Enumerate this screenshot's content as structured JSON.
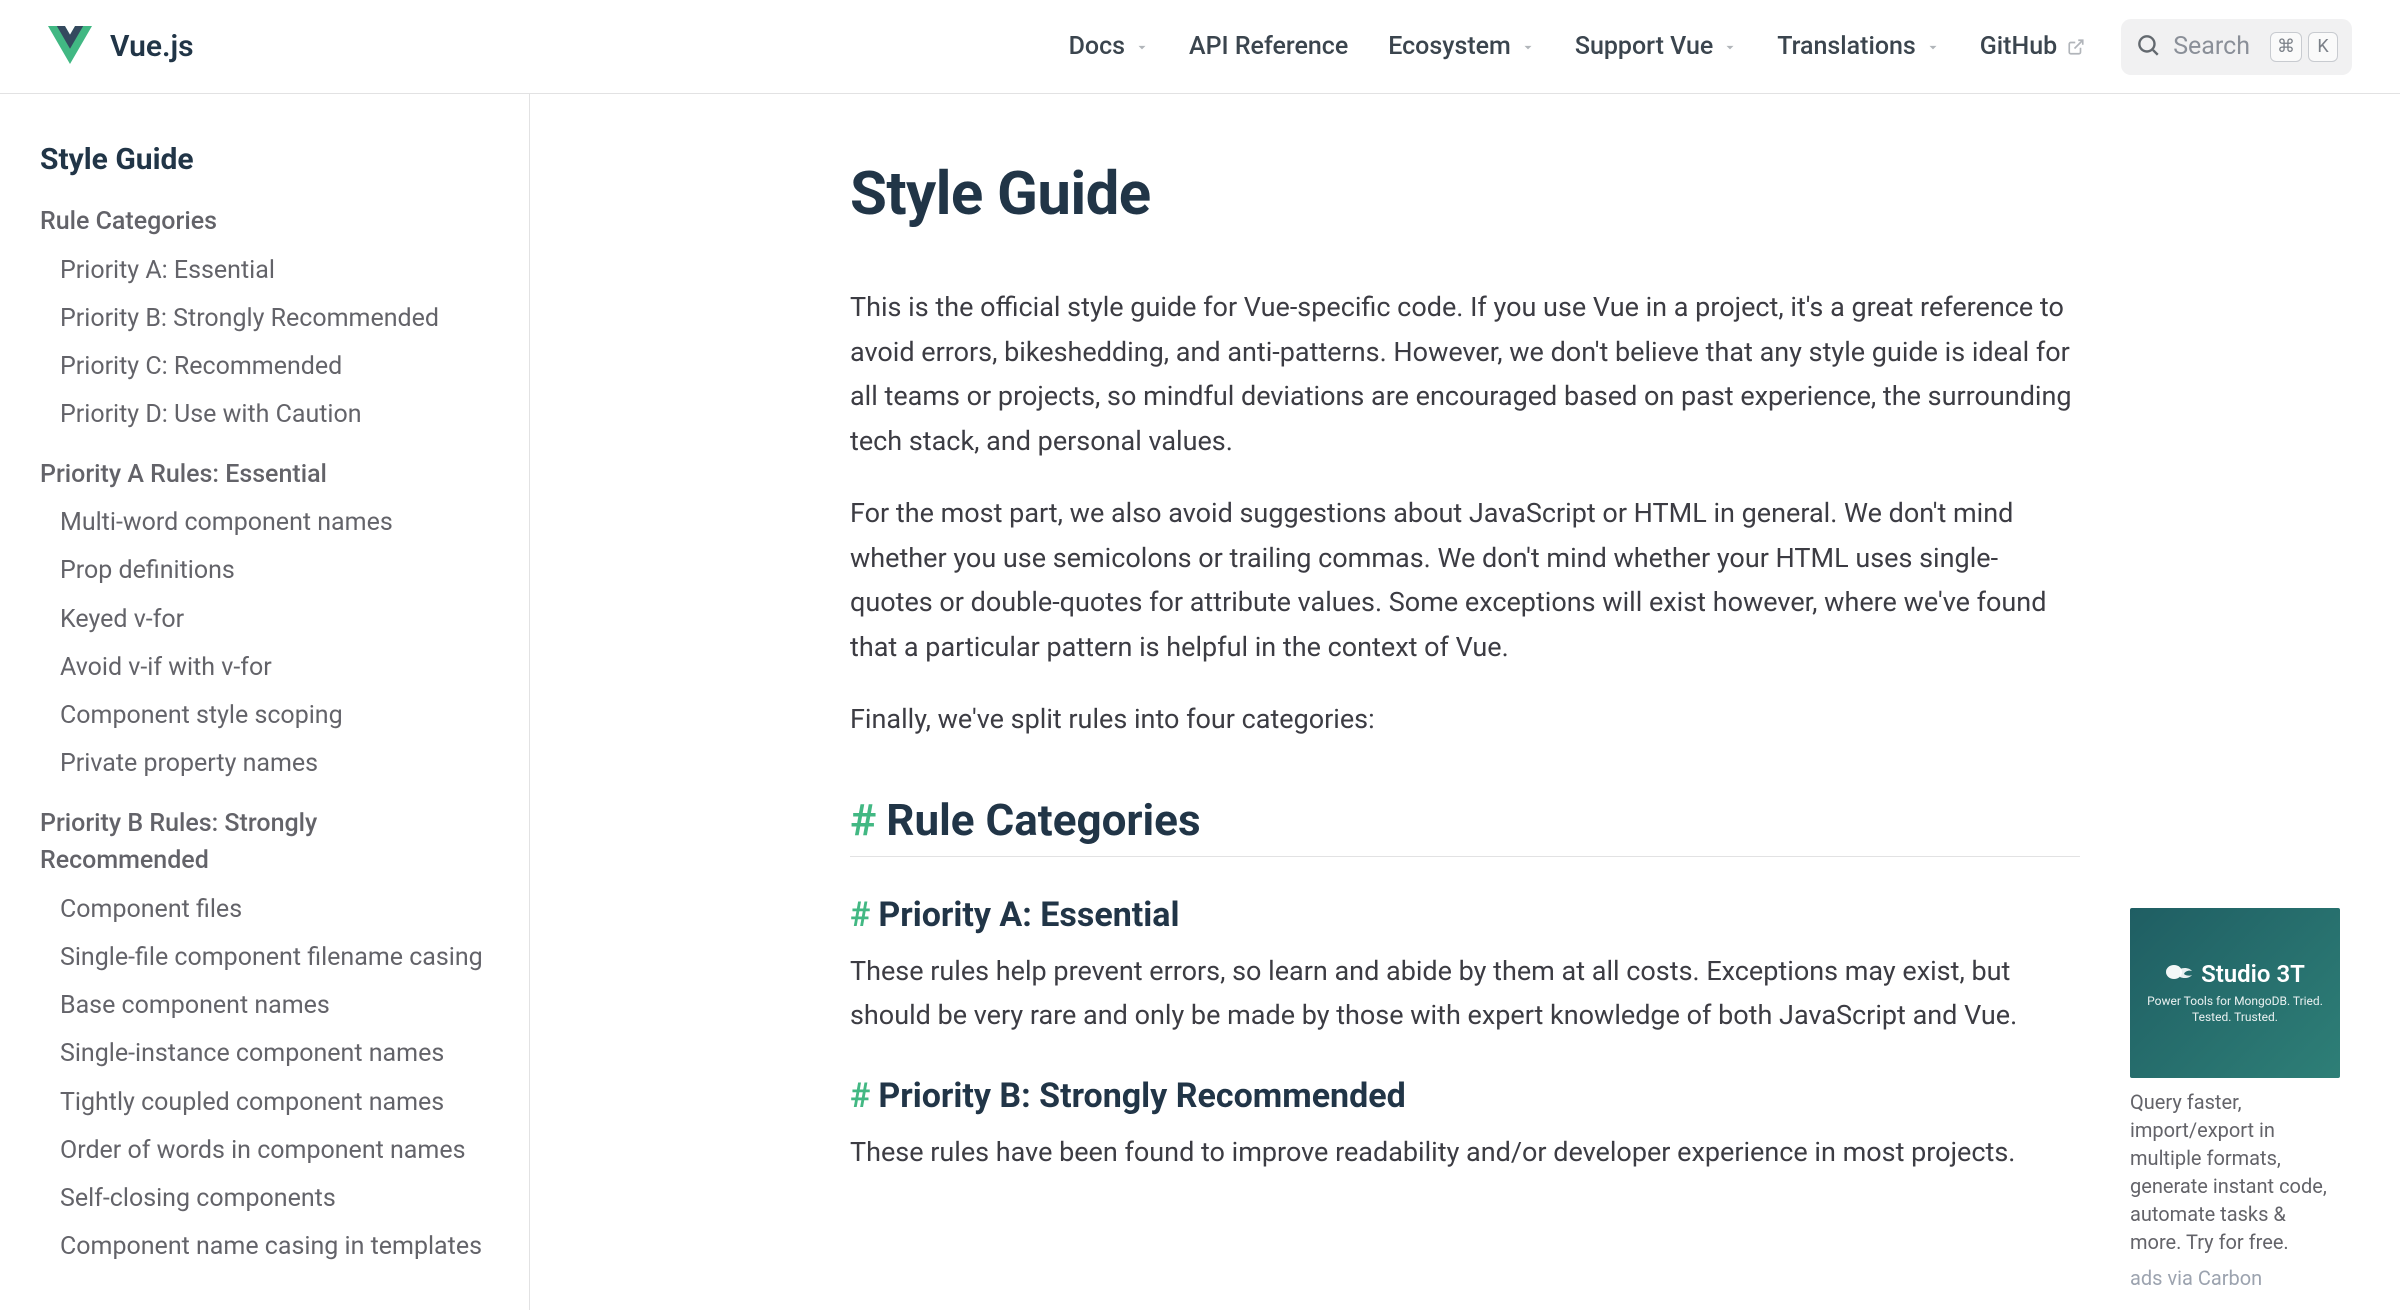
{
  "brand": {
    "name": "Vue.js"
  },
  "nav": {
    "items": [
      {
        "label": "Docs",
        "dropdown": true
      },
      {
        "label": "API Reference",
        "dropdown": false
      },
      {
        "label": "Ecosystem",
        "dropdown": true
      },
      {
        "label": "Support Vue",
        "dropdown": true
      },
      {
        "label": "Translations",
        "dropdown": true
      },
      {
        "label": "GitHub",
        "external": true
      }
    ],
    "search": {
      "placeholder": "Search",
      "kbd1": "⌘",
      "kbd2": "K"
    }
  },
  "sidebar": {
    "title": "Style Guide",
    "groups": [
      {
        "title": "Rule Categories",
        "items": [
          "Priority A: Essential",
          "Priority B: Strongly Recommended",
          "Priority C: Recommended",
          "Priority D: Use with Caution"
        ]
      },
      {
        "title": "Priority A Rules: Essential",
        "items": [
          "Multi-word component names",
          "Prop definitions",
          "Keyed v-for",
          "Avoid v-if with v-for",
          "Component style scoping",
          "Private property names"
        ]
      },
      {
        "title": "Priority B Rules: Strongly Recommended",
        "items": [
          "Component files",
          "Single-file component filename casing",
          "Base component names",
          "Single-instance component names",
          "Tightly coupled component names",
          "Order of words in component names",
          "Self-closing components",
          "Component name casing in templates"
        ]
      }
    ]
  },
  "main": {
    "title": "Style Guide",
    "paragraphs": [
      "This is the official style guide for Vue-specific code. If you use Vue in a project, it's a great reference to avoid errors, bikeshedding, and anti-patterns. However, we don't believe that any style guide is ideal for all teams or projects, so mindful deviations are encouraged based on past experience, the surrounding tech stack, and personal values.",
      "For the most part, we also avoid suggestions about JavaScript or HTML in general. We don't mind whether you use semicolons or trailing commas. We don't mind whether your HTML uses single-quotes or double-quotes for attribute values. Some exceptions will exist however, where we've found that a particular pattern is helpful in the context of Vue.",
      "Finally, we've split rules into four categories:"
    ],
    "h2": "Rule Categories",
    "h3a": "Priority A: Essential",
    "p_a": "These rules help prevent errors, so learn and abide by them at all costs. Exceptions may exist, but should be very rare and only be made by those with expert knowledge of both JavaScript and Vue.",
    "h3b": "Priority B: Strongly Recommended",
    "p_b": "These rules have been found to improve readability and/or developer experience in most projects."
  },
  "ad": {
    "brand_name": "Studio 3T",
    "tagline": "Power Tools for MongoDB. Tried. Tested. Trusted.",
    "text": "Query faster, import/export in multiple formats, generate instant code, automate tasks & more. Try for free.",
    "via": "ads via Carbon"
  }
}
